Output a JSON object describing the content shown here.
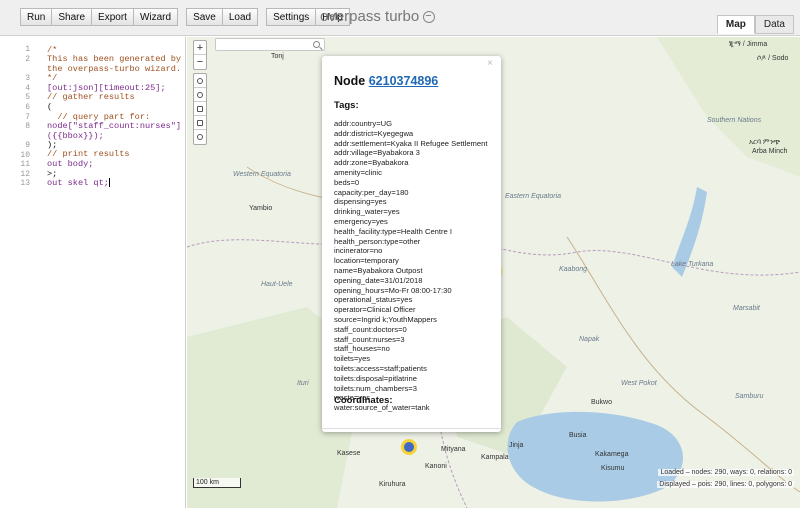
{
  "toolbar": {
    "buttons": [
      "Run",
      "Share",
      "Export",
      "Wizard",
      "Save",
      "Load",
      "Settings",
      "Help"
    ],
    "brand": "overpass turbo",
    "tabs": [
      "Map",
      "Data"
    ]
  },
  "editor": {
    "line_numbers": [
      "1",
      "2",
      "3",
      "4",
      "5",
      "6",
      "7",
      "8",
      "9",
      "10",
      "11",
      "12",
      "13"
    ],
    "lines": [
      "/*",
      "This has been generated by",
      "the overpass-turbo wizard.",
      "*/",
      "[out:json][timeout:25];",
      "// gather results",
      "(",
      "  // query part for:",
      "node[\"staff_count:nurses\"]",
      "({{bbox}});",
      ");",
      "// print results",
      "out body;",
      ">;",
      "out skel qt;"
    ]
  },
  "map": {
    "search_placeholder": "",
    "labels": {
      "tonj": "Tonj",
      "jimma": "ጂማ / Jimma",
      "soddo": "ሶዶ / Sodo",
      "southern_nations": "Southern Nations",
      "arba_minch_am": "አርባ ምንጭ",
      "arba_minch": "Arba Minch",
      "western_equatoria": "Western Equatoria",
      "yambio": "Yambio",
      "eastern_equatoria": "Eastern Equatoria",
      "kaabong": "Kaabong",
      "lake_turkana": "Lake Turkana",
      "haut_uele": "Haut-Uele",
      "marsabit": "Marsabit",
      "napak": "Napak",
      "ituri": "Ituri",
      "west_pokot": "West Pokot",
      "samburu": "Samburu",
      "bukwo": "Bukwo",
      "kasese": "Kasese",
      "mityana": "Mityana",
      "kampala": "Kampala",
      "jinja": "Jinja",
      "busia": "Busia",
      "kakamega": "Kakamega",
      "kisumu": "Kisumu",
      "kanoni": "Kanoni",
      "kiruhura": "Kiruhura"
    },
    "scale": "100 km",
    "stats_loaded": "Loaded – nodes: 290, ways: 0, relations: 0",
    "stats_displayed": "Displayed – pois: 290, lines: 0, polygons: 0"
  },
  "popup": {
    "close": "×",
    "title_prefix": "Node",
    "node_id": "6210374896",
    "tags_heading": "Tags:",
    "tags": [
      "addr:country=UG",
      "addr:district=Kyegegwa",
      "addr:settlement=Kyaka II Refugee Settlement",
      "addr:village=Byabakora 3",
      "addr:zone=Byabakora",
      "amenity=clinic",
      "beds=0",
      "capacity:per_day=180",
      "dispensing=yes",
      "drinking_water=yes",
      "emergency=yes",
      "health_facility:type=Health Centre I",
      "health_person:type=other",
      "incinerator=no",
      "location=temporary",
      "name=Byabakora Outpost",
      "opening_date=31/01/2018",
      "opening_hours=Mo-Fr 08:00-17:30",
      "operational_status=yes",
      "operator=Clinical Officer",
      "source=Ingrid k;YouthMappers",
      "staff_count:doctors=0",
      "staff_count:nurses=3",
      "staff_houses=no",
      "toilets=yes",
      "toilets:access=staff;patients",
      "toilets:disposal=pitlatrine",
      "toilets:num_chambers=3",
      "waste=yes",
      "water:source_of_water=tank"
    ],
    "coords_heading": "Coordinates:"
  },
  "colors": {
    "link": "#1f68b5",
    "marker_fill": "#4068c8",
    "marker_ring": "#f6d234",
    "comment": "#a0501e",
    "keyword": "#7a2a8c"
  }
}
